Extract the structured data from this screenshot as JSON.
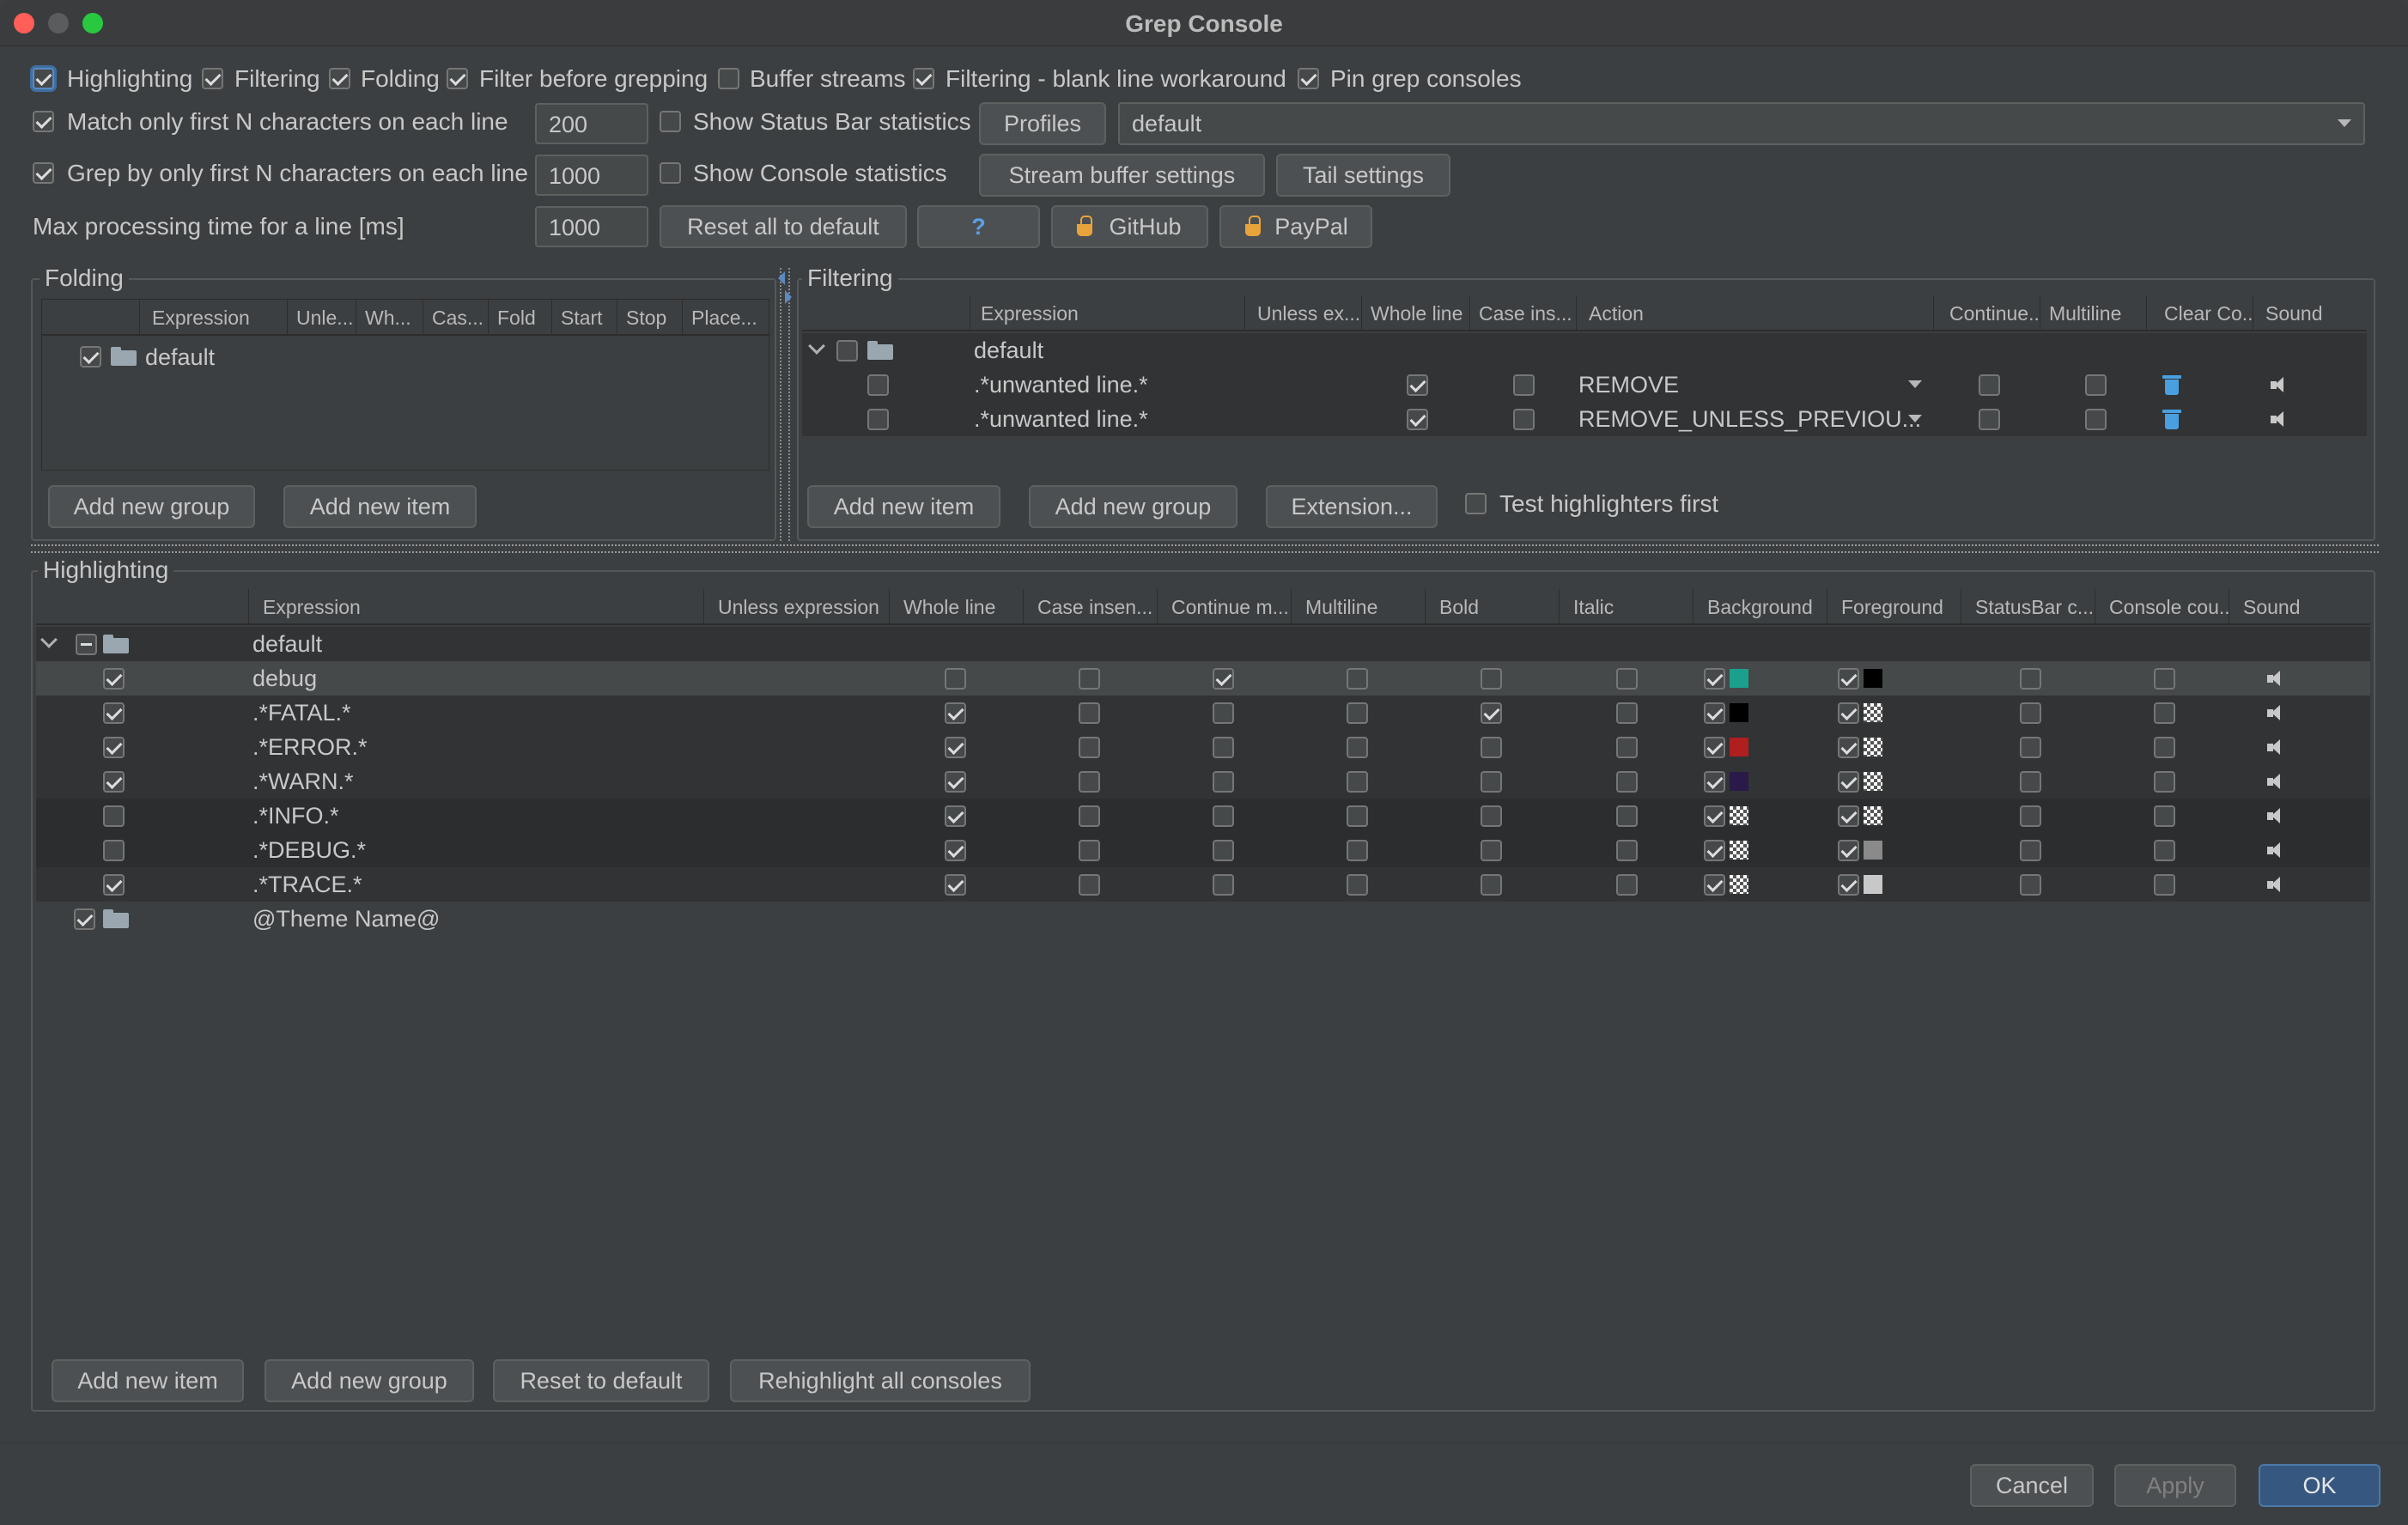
{
  "window": {
    "title": "Grep Console"
  },
  "options": {
    "row1": [
      {
        "label": "Highlighting",
        "checked": true
      },
      {
        "label": "Filtering",
        "checked": true
      },
      {
        "label": "Folding",
        "checked": true
      },
      {
        "label": "Filter before grepping",
        "checked": true
      },
      {
        "label": "Buffer streams",
        "checked": false
      },
      {
        "label": "Filtering - blank line workaround",
        "checked": true
      },
      {
        "label": "Pin grep consoles",
        "checked": true
      }
    ],
    "match_first_n": {
      "label": "Match only first N characters on each line",
      "value": "200",
      "checked": true
    },
    "grep_first_n": {
      "label": "Grep by only first N characters on each line",
      "value": "1000",
      "checked": true
    },
    "max_processing": {
      "label": "Max processing time for a line [ms]",
      "value": "1000"
    },
    "show_status_bar": {
      "label": "Show Status Bar statistics",
      "checked": false
    },
    "show_console": {
      "label": "Show Console statistics",
      "checked": false
    },
    "profiles_label": "Profiles",
    "profile_value": "default",
    "stream_buffer_label": "Stream buffer settings",
    "tail_settings_label": "Tail settings",
    "reset_all_label": "Reset all to default",
    "help_label": "?",
    "github_label": "GitHub",
    "paypal_label": "PayPal"
  },
  "folding": {
    "title": "Folding",
    "columns": [
      "Expression",
      "Unle...",
      "Wh...",
      "Cas...",
      "Fold",
      "Start",
      "Stop",
      "Place..."
    ],
    "group": "default",
    "add_group_label": "Add new group",
    "add_item_label": "Add new item"
  },
  "filtering": {
    "title": "Filtering",
    "columns": [
      "Expression",
      "Unless ex...",
      "Whole line",
      "Case ins...",
      "Action",
      "Continue...",
      "Multiline",
      "Clear Co...",
      "Sound"
    ],
    "group": "default",
    "rows": [
      {
        "expression": ".*unwanted line.*",
        "action": "REMOVE"
      },
      {
        "expression": ".*unwanted line.*",
        "action": "REMOVE_UNLESS_PREVIOU..."
      }
    ],
    "add_item_label": "Add new item",
    "add_group_label": "Add new group",
    "extension_label": "Extension...",
    "test_highlighters_label": "Test highlighters first"
  },
  "highlighting": {
    "title": "Highlighting",
    "columns": [
      "Expression",
      "Unless expression",
      "Whole line",
      "Case insen...",
      "Continue m...",
      "Multiline",
      "Bold",
      "Italic",
      "Background",
      "Foreground",
      "StatusBar c...",
      "Console cou...",
      "Sound"
    ],
    "group": "default",
    "rows": [
      {
        "expression": "debug",
        "enabled": true,
        "whole": false,
        "cont": true,
        "bold": false,
        "bg": "#1aa08c",
        "fg": "#000000",
        "bgchk": false,
        "fgchk": false
      },
      {
        "expression": ".*FATAL.*",
        "enabled": true,
        "whole": true,
        "cont": false,
        "bold": true,
        "bg": "#000000",
        "fg": "checker",
        "bgchk": false,
        "fgchk": true
      },
      {
        "expression": ".*ERROR.*",
        "enabled": true,
        "whole": true,
        "cont": false,
        "bold": false,
        "bg": "#b01e1e",
        "fg": "checker",
        "bgchk": false,
        "fgchk": true
      },
      {
        "expression": ".*WARN.*",
        "enabled": true,
        "whole": true,
        "cont": false,
        "bold": false,
        "bg": "#2a1a4a",
        "fg": "checker",
        "bgchk": false,
        "fgchk": true
      },
      {
        "expression": ".*INFO.*",
        "enabled": false,
        "whole": true,
        "cont": false,
        "bold": false,
        "bg": "checker",
        "fg": "checker",
        "bgchk": true,
        "fgchk": true
      },
      {
        "expression": ".*DEBUG.*",
        "enabled": false,
        "whole": true,
        "cont": false,
        "bold": false,
        "bg": "checker",
        "fg": "#8a8a8a",
        "bgchk": true,
        "fgchk": false
      },
      {
        "expression": ".*TRACE.*",
        "enabled": true,
        "whole": true,
        "cont": false,
        "bold": false,
        "bg": "checker",
        "fg": "#c8c8c8",
        "bgchk": true,
        "fgchk": false
      }
    ],
    "theme_group": "@Theme Name@",
    "add_item_label": "Add new item",
    "add_group_label": "Add new group",
    "reset_label": "Reset to default",
    "rehighlight_label": "Rehighlight all consoles"
  },
  "footer": {
    "cancel_label": "Cancel",
    "apply_label": "Apply",
    "ok_label": "OK"
  }
}
